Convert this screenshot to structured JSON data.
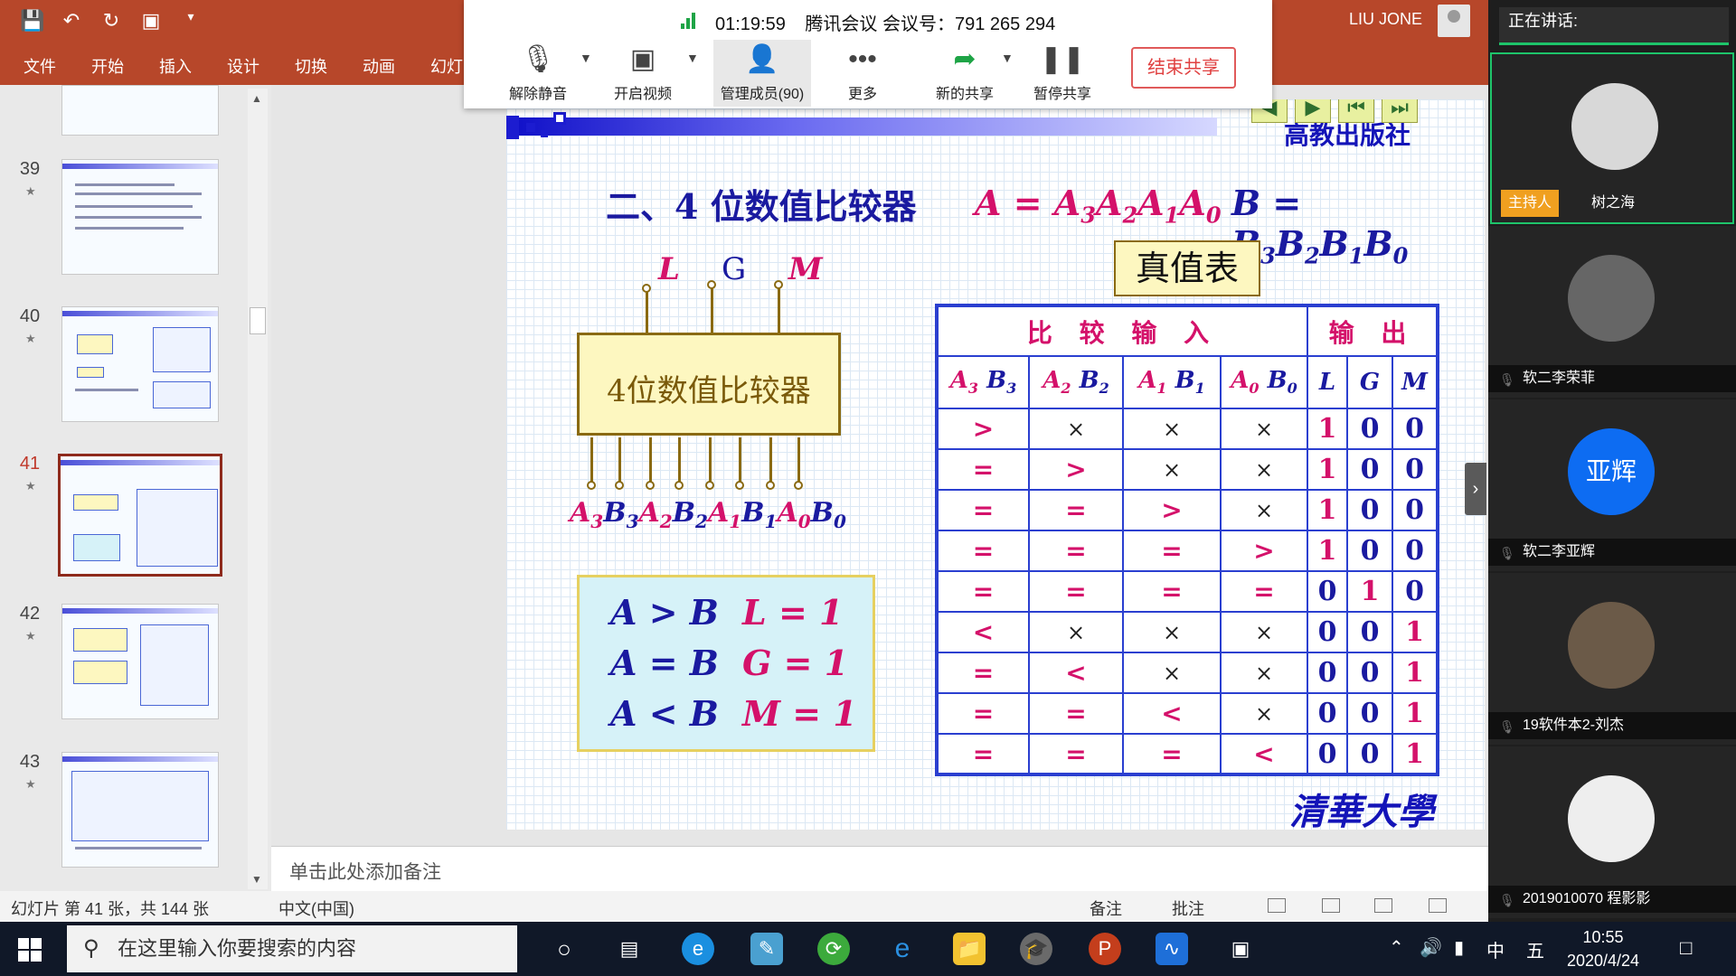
{
  "ppt": {
    "user_name": "LIU JONE",
    "ribbon_tabs": [
      "文件",
      "开始",
      "插入",
      "设计",
      "切换",
      "动画",
      "幻灯"
    ],
    "status_slide": "幻灯片 第 41 张，共 144 张",
    "status_lang": "中文(中国)",
    "status_notes": "备注",
    "status_comments": "批注",
    "notes_placeholder": "单击此处添加备注",
    "thumbnails": [
      {
        "num": "39"
      },
      {
        "num": "40"
      },
      {
        "num": "41"
      },
      {
        "num": "42"
      },
      {
        "num": "43"
      }
    ]
  },
  "meeting": {
    "time": "01:19:59",
    "title": "腾讯会议 会议号：791 265 294",
    "buttons": {
      "unmute": "解除静音",
      "video": "开启视频",
      "members": "管理成员(90)",
      "more": "更多",
      "new_share": "新的共享",
      "pause_share": "暂停共享"
    },
    "end_share": "结束共享",
    "speaking_label": "正在讲话:",
    "host_badge": "主持人",
    "participants": [
      {
        "name": "树之海"
      },
      {
        "name": "软二李荣菲"
      },
      {
        "name": "软二李亚辉",
        "avatar_text": "亚辉"
      },
      {
        "name": "19软件本2-刘杰"
      },
      {
        "name": "2019010070 程影影"
      }
    ]
  },
  "slide": {
    "publisher": "高教出版社",
    "title": "二、4 位数值比较器",
    "eq_a": {
      "lhs": "A",
      "parts": [
        "A",
        "3",
        "A",
        "2",
        "A",
        "1",
        "A",
        "0"
      ]
    },
    "eq_b": {
      "lhs": "B",
      "parts": [
        "B",
        "3",
        "B",
        "2",
        "B",
        "1",
        "B",
        "0"
      ]
    },
    "outputs": [
      "L",
      "G",
      "M"
    ],
    "chip_label": "4位数值比较器",
    "inputs": [
      "A",
      "3",
      "B",
      "3",
      "A",
      "2",
      "B",
      "2",
      "A",
      "1",
      "B",
      "1",
      "A",
      "0",
      "B",
      "0"
    ],
    "conditions": [
      {
        "left": "A > B",
        "right": "L = 1"
      },
      {
        "left": "A = B",
        "right": "G = 1"
      },
      {
        "left": "A < B",
        "right": "M = 1"
      }
    ],
    "truth_table_title": "真值表",
    "header_inputs": "比 较 输 入",
    "header_outputs": "输 出",
    "col_headers": [
      {
        "a": "A",
        "as": "3",
        "b": "B",
        "bs": "3"
      },
      {
        "a": "A",
        "as": "2",
        "b": "B",
        "bs": "2"
      },
      {
        "a": "A",
        "as": "1",
        "b": "B",
        "bs": "1"
      },
      {
        "a": "A",
        "as": "0",
        "b": "B",
        "bs": "0"
      }
    ],
    "out_headers": [
      "L",
      "G",
      "M"
    ],
    "rows": [
      [
        ">",
        "×",
        "×",
        "×",
        "1",
        "0",
        "0"
      ],
      [
        "=",
        ">",
        "×",
        "×",
        "1",
        "0",
        "0"
      ],
      [
        "=",
        "=",
        ">",
        "×",
        "1",
        "0",
        "0"
      ],
      [
        "=",
        "=",
        "=",
        ">",
        "1",
        "0",
        "0"
      ],
      [
        "=",
        "=",
        "=",
        "=",
        "0",
        "1",
        "0"
      ],
      [
        "<",
        "×",
        "×",
        "×",
        "0",
        "0",
        "1"
      ],
      [
        "=",
        "<",
        "×",
        "×",
        "0",
        "0",
        "1"
      ],
      [
        "=",
        "=",
        "<",
        "×",
        "0",
        "0",
        "1"
      ],
      [
        "=",
        "=",
        "=",
        "<",
        "0",
        "0",
        "1"
      ]
    ],
    "university_mark": "清華大學"
  },
  "taskbar": {
    "search_placeholder": "在这里输入你要搜索的内容",
    "time": "10:55",
    "date": "2020/4/24",
    "ime_lang": "中",
    "ime_mode": "五"
  }
}
